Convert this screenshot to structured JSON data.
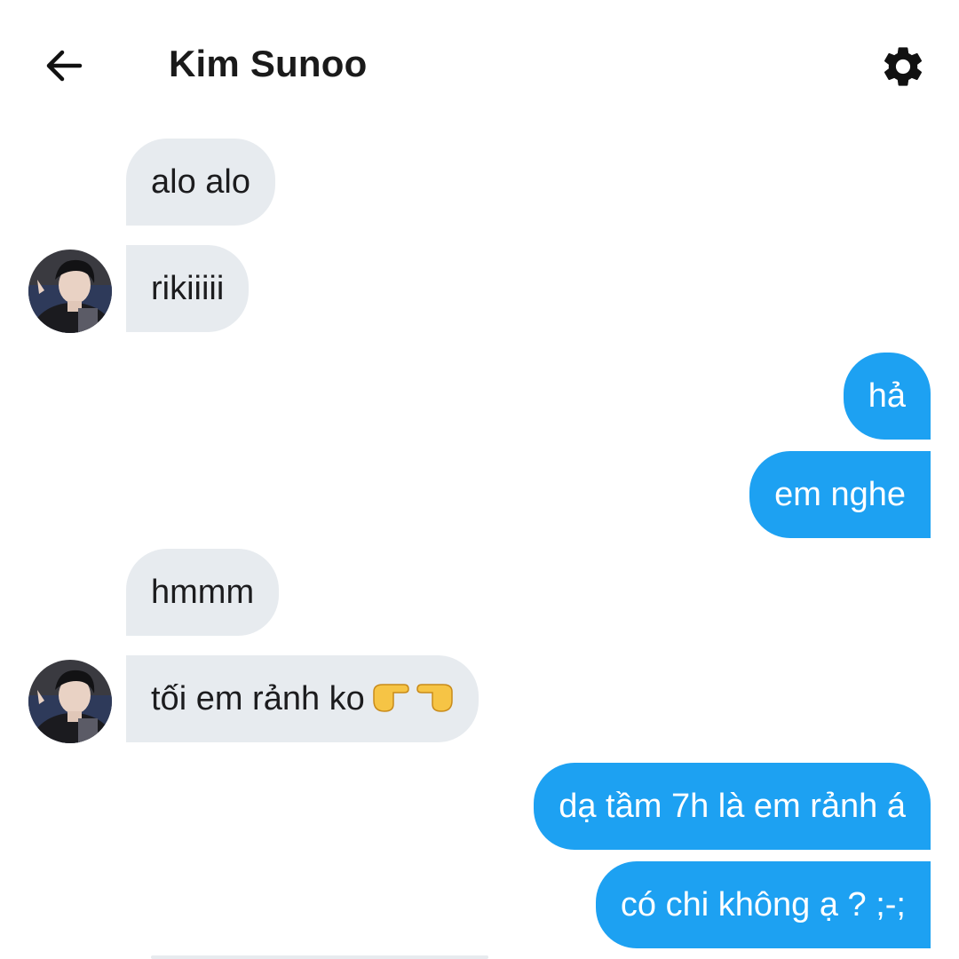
{
  "header": {
    "back_icon": "arrow-left-icon",
    "title": "Kim Sunoo",
    "settings_icon": "gear-icon"
  },
  "colors": {
    "incoming_bubble": "#e7ebef",
    "outgoing_bubble": "#1da1f2",
    "outgoing_text": "#ffffff",
    "incoming_text": "#1c1c1e"
  },
  "messages": [
    {
      "side": "in",
      "text": "alo alo"
    },
    {
      "side": "in",
      "text": "rikiiiii"
    },
    {
      "side": "out",
      "text": "hả"
    },
    {
      "side": "out",
      "text": "em nghe"
    },
    {
      "side": "in",
      "text": "hmmm"
    },
    {
      "side": "in",
      "text": "tối em rảnh ko"
    },
    {
      "side": "out",
      "text": "dạ tầm 7h là em rảnh á"
    },
    {
      "side": "out",
      "text": "có chi không ạ ? ;-;"
    }
  ],
  "emoji": {
    "pointing_hands": "pointing-hands-icon"
  }
}
